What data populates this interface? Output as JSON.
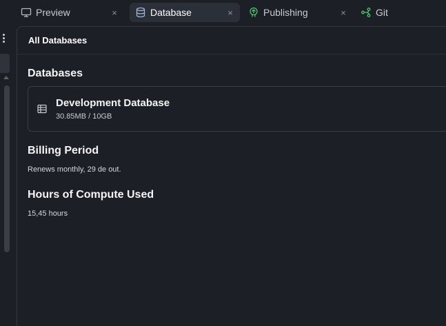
{
  "tabs": [
    {
      "label": "Preview",
      "icon": "monitor-icon",
      "active": false,
      "closable": true
    },
    {
      "label": "Database",
      "icon": "database-icon",
      "active": true,
      "closable": true
    },
    {
      "label": "Publishing",
      "icon": "publishing-icon",
      "active": false,
      "closable": true
    },
    {
      "label": "Git",
      "icon": "git-branch-icon",
      "active": false,
      "closable": false
    }
  ],
  "close_glyph": "×",
  "panel": {
    "header": "All Databases",
    "databases_title": "Databases",
    "database": {
      "name": "Development Database",
      "usage": "30.85MB / 10GB",
      "icon": "table-icon"
    },
    "billing": {
      "title": "Billing Period",
      "text": "Renews monthly, 29 de out."
    },
    "compute": {
      "title": "Hours of Compute Used",
      "text": "15,45 hours"
    }
  },
  "colors": {
    "background": "#1c1f26",
    "active_tab": "#2b2f38",
    "publishing_icon": "#4cc36b",
    "git_icon": "#4cc36b",
    "database_icon": "#9fb4e0"
  }
}
